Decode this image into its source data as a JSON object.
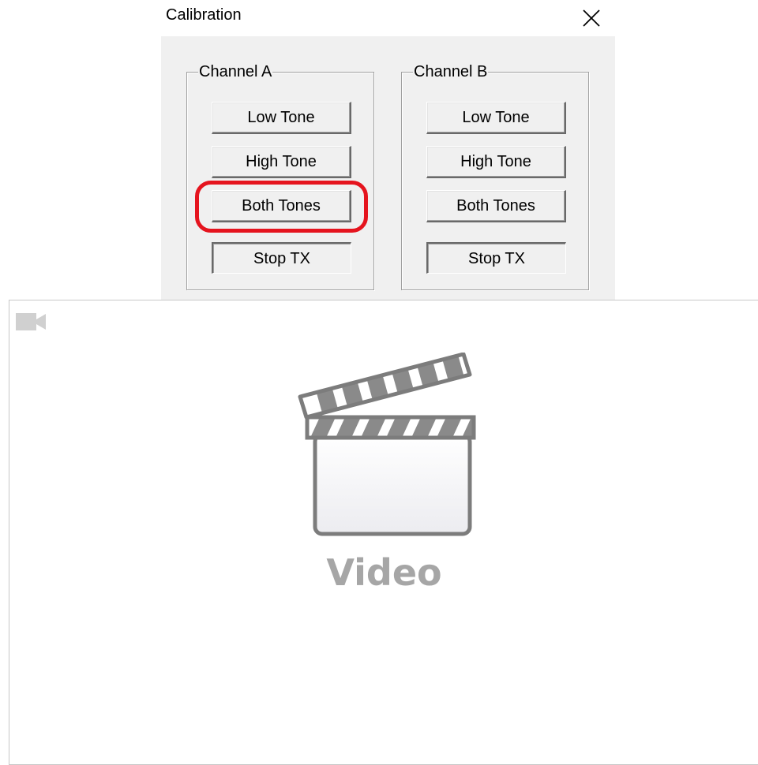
{
  "dialog": {
    "title": "Calibration",
    "close_icon": "close-icon",
    "channel_a": {
      "label": "Channel A",
      "buttons": [
        "Low Tone",
        "High Tone",
        "Both Tones"
      ],
      "stop_label": "Stop TX"
    },
    "channel_b": {
      "label": "Channel B",
      "buttons": [
        "Low Tone",
        "High Tone",
        "Both Tones"
      ],
      "stop_label": "Stop TX"
    },
    "highlight_color": "#e5141e"
  },
  "video": {
    "label": "Video",
    "icons": [
      "video-camera-icon",
      "clapperboard-icon"
    ]
  }
}
